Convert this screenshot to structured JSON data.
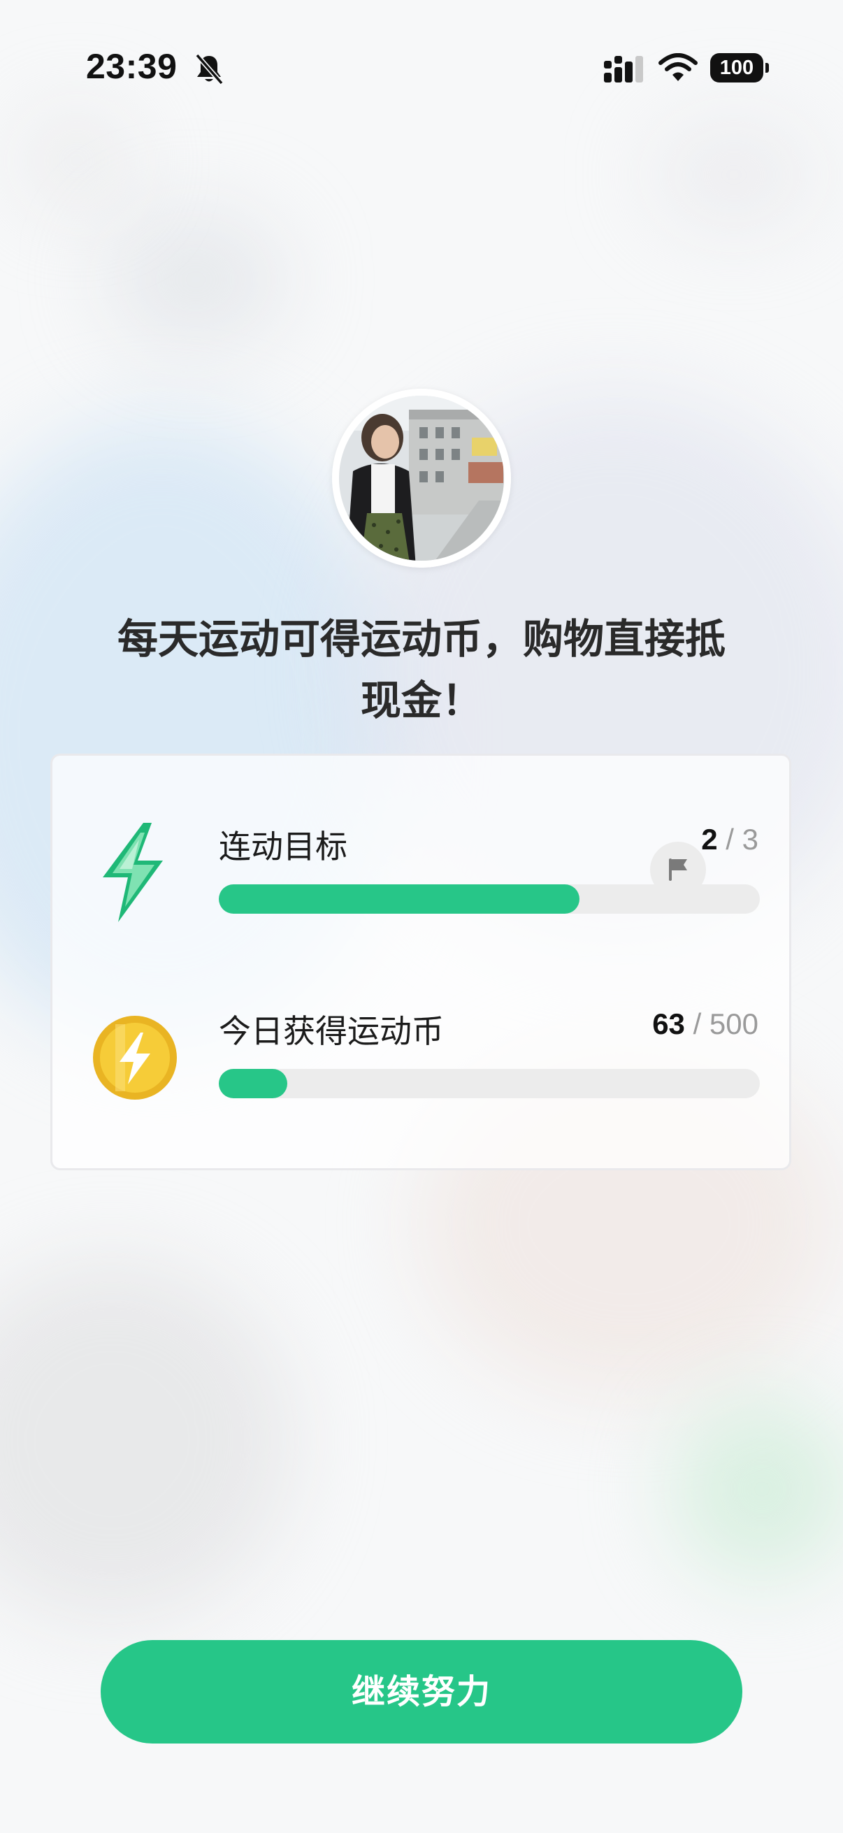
{
  "status_bar": {
    "time": "23:39",
    "battery": "100",
    "icons": [
      "bell-muted-icon",
      "cellular-signal-icon",
      "wifi-icon",
      "battery-icon"
    ]
  },
  "avatar": {
    "icon": "user-avatar"
  },
  "headline": {
    "line1": "每天运动可得运动币，购物直接抵",
    "line2": "现金！"
  },
  "progress": {
    "streak": {
      "icon": "lightning-icon",
      "label": "连动目标",
      "current": "2",
      "separator": " / ",
      "total": "3",
      "progress": 0.667,
      "end_icon": "flag-icon"
    },
    "coins": {
      "icon": "coin-icon",
      "label": "今日获得运动币",
      "current": "63",
      "separator": " / ",
      "total": "500",
      "progress": 0.126
    }
  },
  "cta": {
    "label": "继续努力"
  },
  "colors": {
    "accent": "#26c688",
    "track": "#ececec",
    "coin": "#f2c230"
  }
}
